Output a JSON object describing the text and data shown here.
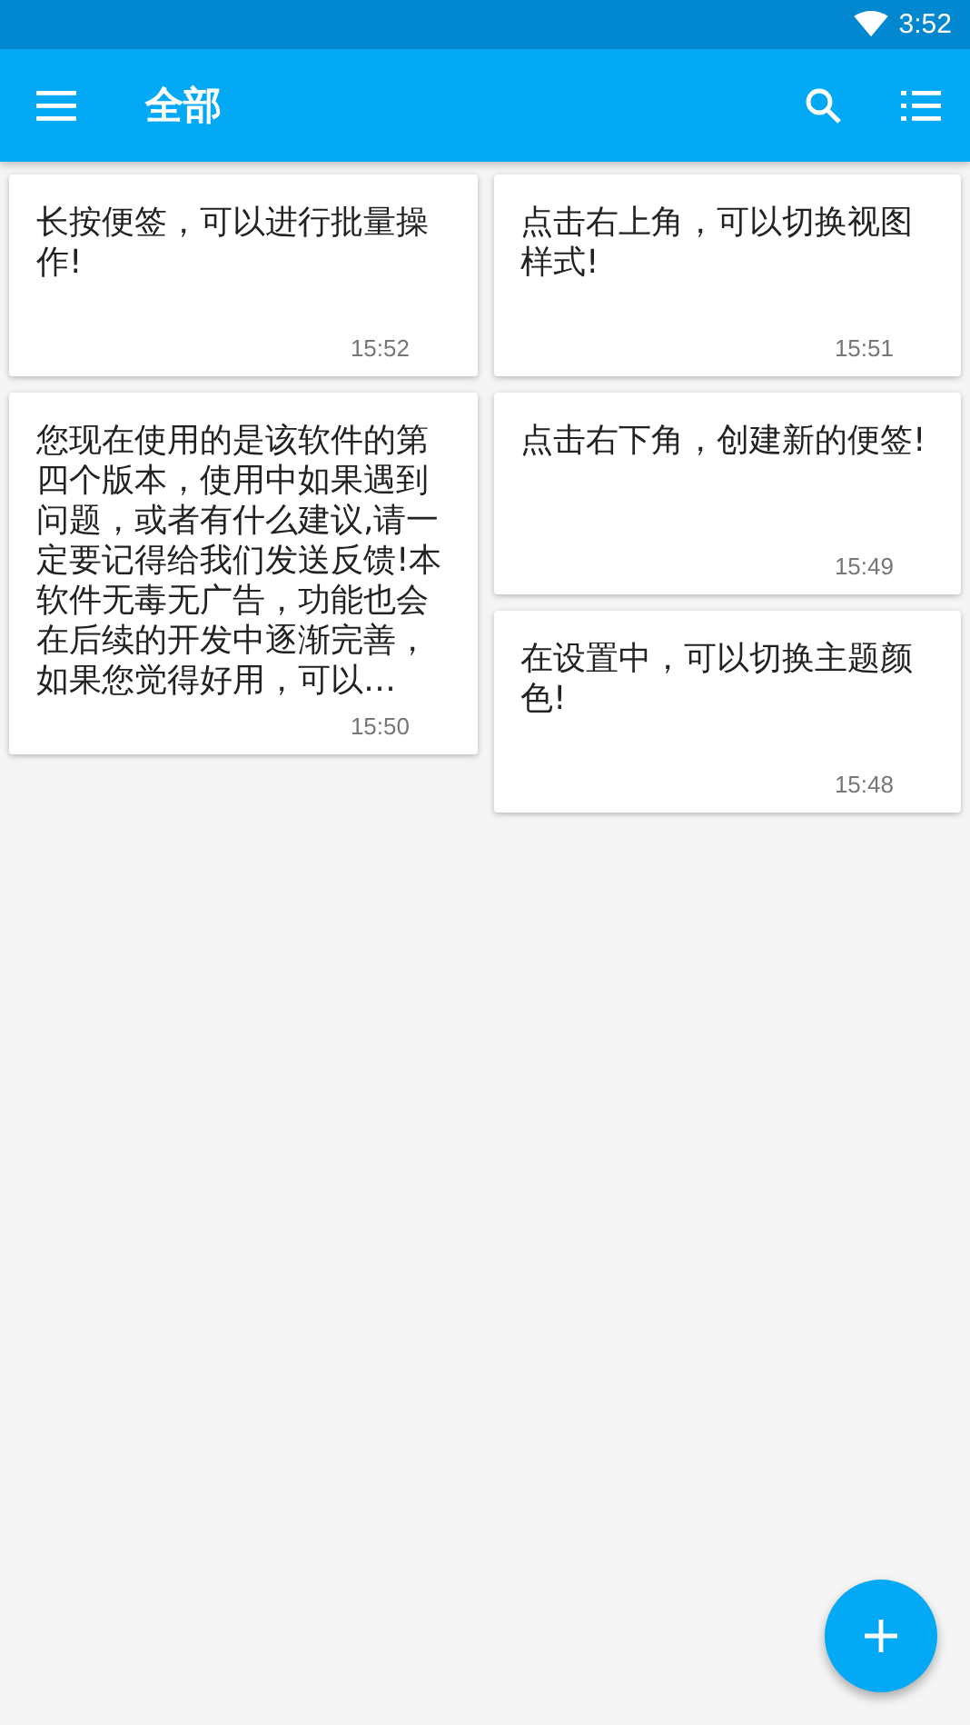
{
  "status_bar": {
    "time": "3:52"
  },
  "app_bar": {
    "title": "全部"
  },
  "columns": [
    [
      {
        "text": "长按便签，可以进行批量操作!",
        "time": "15:52"
      },
      {
        "text": "您现在使用的是该软件的第四个版本，使用中如果遇到问题，或者有什么建议,请一定要记得给我们发送反馈!本软件无毒无广告，功能也会在后续的开发中逐渐完善，如果您觉得好用，可以…",
        "time": "15:50"
      }
    ],
    [
      {
        "text": "点击右上角，可以切换视图样式!",
        "time": "15:51"
      },
      {
        "text": "点击右下角，创建新的便签!",
        "time": "15:49"
      },
      {
        "text": "在设置中，可以切换主题颜色!",
        "time": "15:48"
      }
    ]
  ]
}
